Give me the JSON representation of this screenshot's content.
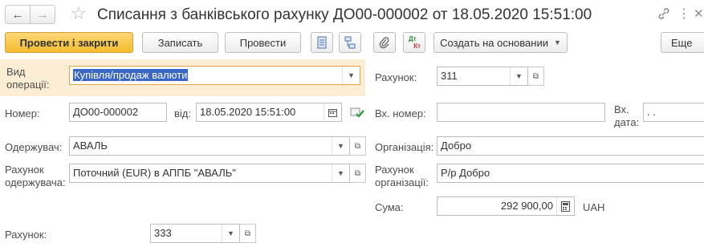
{
  "window": {
    "title": "Списання з банківського рахунку ДО00-000002 от 18.05.2020 15:51:00"
  },
  "nav": {
    "back_glyph": "←",
    "forward_glyph": "→"
  },
  "toolbar": {
    "post_close_label": "Провести і закрити",
    "write_label": "Записать",
    "post_label": "Провести",
    "create_based_label": "Создать на основании",
    "more_label": "Еще",
    "dt_kt_top": "Дт",
    "dt_kt_bottom": "Кт"
  },
  "form": {
    "operation_type": {
      "label_line1": "Вид",
      "label_line2": "операції:",
      "value": "Купівля/продаж валюти"
    },
    "number": {
      "label": "Номер:",
      "value": "ДО00-000002"
    },
    "date": {
      "label": "від:",
      "value": "18.05.2020 15:51:00"
    },
    "recipient": {
      "label": "Одержувач:",
      "value": "АВАЛЬ"
    },
    "recipient_account": {
      "label_line1": "Рахунок",
      "label_line2": "одержувача:",
      "value": "Поточний (EUR) в АППБ \"АВАЛЬ\""
    },
    "account_top": {
      "label": "Рахунок:",
      "value": "311"
    },
    "incoming_number": {
      "label": "Вх. номер:",
      "value": ""
    },
    "incoming_date": {
      "label_line1": "Вх.",
      "label_line2": "дата:",
      "value": " .  ."
    },
    "organization": {
      "label": "Організація:",
      "value": "Добро"
    },
    "org_account": {
      "label_line1": "Рахунок",
      "label_line2": "організації:",
      "value": "Р/р Добро"
    },
    "amount": {
      "label": "Сума:",
      "value": "292 900,00",
      "currency": "UAH"
    },
    "account_bottom": {
      "label": "Рахунок:",
      "value": "333"
    }
  },
  "colors": {
    "primary_button": "#f5bc2e",
    "highlight_row": "#fbeed5",
    "selection": "#3a66c8"
  }
}
